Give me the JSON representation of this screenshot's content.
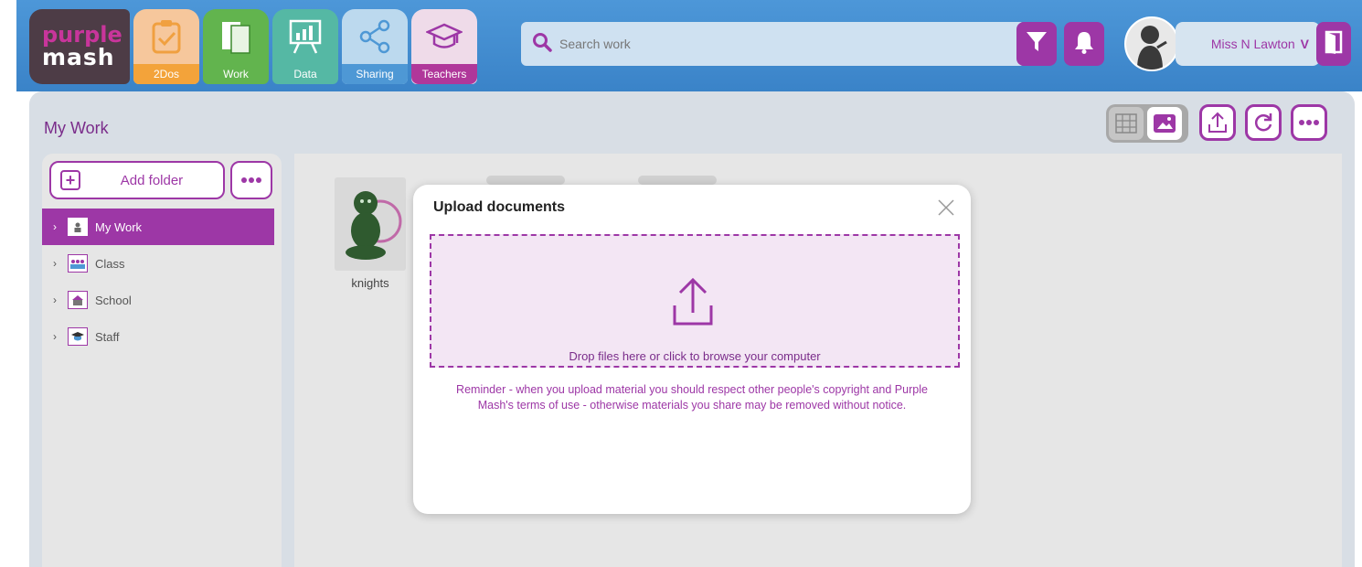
{
  "logo": {
    "line1": "purple",
    "line2": "mash"
  },
  "nav_tabs": [
    {
      "label": "2Dos",
      "icon": "checklist-icon"
    },
    {
      "label": "Work",
      "icon": "documents-icon"
    },
    {
      "label": "Data",
      "icon": "chart-easel-icon"
    },
    {
      "label": "Sharing",
      "icon": "share-icon"
    },
    {
      "label": "Teachers",
      "icon": "graduation-cap-icon"
    }
  ],
  "search": {
    "placeholder": "Search work"
  },
  "user": {
    "name": "Miss N Lawton",
    "chevron": "V"
  },
  "page": {
    "title": "My Work"
  },
  "sidebar": {
    "add_folder_label": "Add folder",
    "items": [
      {
        "label": "My Work",
        "selected": true
      },
      {
        "label": "Class",
        "selected": false
      },
      {
        "label": "School",
        "selected": false
      },
      {
        "label": "Staff",
        "selected": false
      }
    ]
  },
  "files": [
    {
      "name": "knights"
    }
  ],
  "modal": {
    "title": "Upload documents",
    "drop_text": "Drop files here or click to browse your computer",
    "reminder": "Reminder - when you upload material you should respect other people's copyright and Purple Mash's terms of use - otherwise materials you share may be removed without notice."
  },
  "colors": {
    "accent": "#9d37a6",
    "topbar": "#3a83c8",
    "panel": "#d8dee5"
  }
}
